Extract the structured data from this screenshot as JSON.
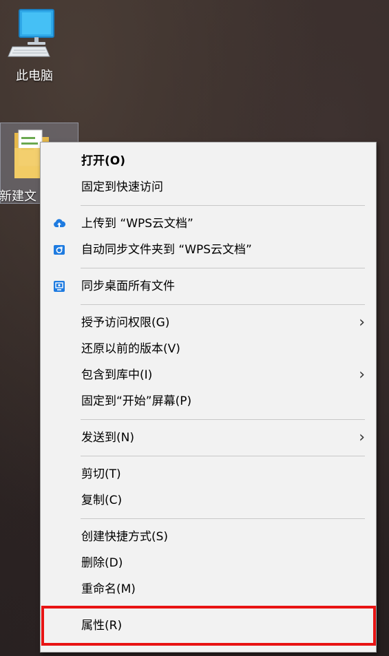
{
  "desktop": {
    "icons": [
      {
        "label": "此电脑",
        "icon": "computer-icon"
      },
      {
        "label": "新建文",
        "icon": "folder-icon"
      }
    ]
  },
  "context_menu": {
    "groups": [
      [
        {
          "label": "打开(O)",
          "bold": true
        },
        {
          "label": "固定到快速访问"
        }
      ],
      [
        {
          "label": "上传到 “WPS云文档”",
          "icon": "cloud-upload-icon"
        },
        {
          "label": "自动同步文件夹到 “WPS云文档”",
          "icon": "folder-sync-icon"
        }
      ],
      [
        {
          "label": "同步桌面所有文件",
          "icon": "desktop-sync-icon"
        }
      ],
      [
        {
          "label": "授予访问权限(G)",
          "submenu": true
        },
        {
          "label": "还原以前的版本(V)"
        },
        {
          "label": "包含到库中(I)",
          "submenu": true
        },
        {
          "label": "固定到“开始”屏幕(P)"
        }
      ],
      [
        {
          "label": "发送到(N)",
          "submenu": true
        }
      ],
      [
        {
          "label": "剪切(T)"
        },
        {
          "label": "复制(C)"
        }
      ],
      [
        {
          "label": "创建快捷方式(S)"
        },
        {
          "label": "删除(D)"
        },
        {
          "label": "重命名(M)"
        }
      ],
      [
        {
          "label": "属性(R)",
          "highlighted": true
        }
      ]
    ]
  },
  "colors": {
    "menu_bg": "#f2f2f2",
    "highlight": "#e81414",
    "wps_blue": "#1e7be0"
  }
}
